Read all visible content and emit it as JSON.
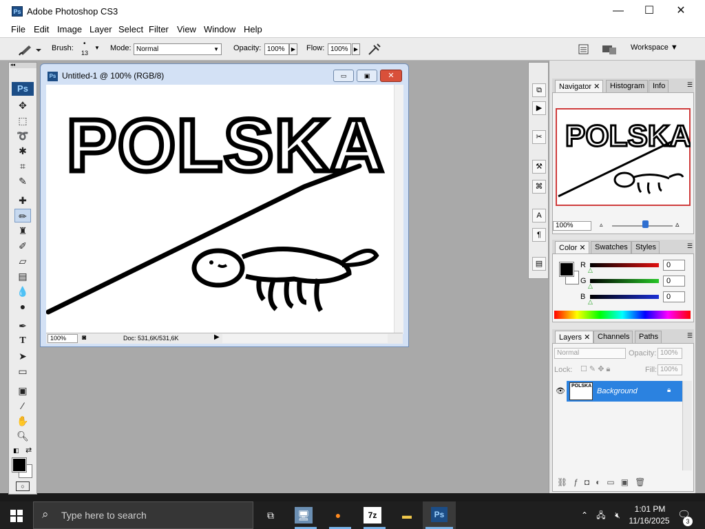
{
  "app": {
    "title": "Adobe Photoshop CS3",
    "icon_text": "Ps"
  },
  "window_controls": {
    "minimize": "—",
    "maximize": "☐",
    "close": "✕"
  },
  "menu": [
    "File",
    "Edit",
    "Image",
    "Layer",
    "Select",
    "Filter",
    "View",
    "Window",
    "Help"
  ],
  "options_bar": {
    "brush_label": "Brush:",
    "brush_size": "13",
    "mode_label": "Mode:",
    "mode_value": "Normal",
    "opacity_label": "Opacity:",
    "opacity_value": "100%",
    "flow_label": "Flow:",
    "flow_value": "100%",
    "workspace_label": "Workspace"
  },
  "tools_panel": {
    "logo": "Ps"
  },
  "document": {
    "title": "Untitled-1 @ 100% (RGB/8)",
    "zoom": "100%",
    "doc_info": "Doc: 531,6K/531,6K",
    "drawing_text": "POLSKA"
  },
  "navigator": {
    "tabs": [
      "Navigator",
      "Histogram",
      "Info"
    ],
    "zoom": "100%",
    "zoom_slider_level": 0.55
  },
  "color_panel": {
    "tabs": [
      "Color",
      "Swatches",
      "Styles"
    ],
    "channels": [
      {
        "label": "R",
        "value": "0",
        "color": "#d21f1f"
      },
      {
        "label": "G",
        "value": "0",
        "color": "#27c627"
      },
      {
        "label": "B",
        "value": "0",
        "color": "#1a2fd6"
      }
    ]
  },
  "layers_panel": {
    "tabs": [
      "Layers",
      "Channels",
      "Paths"
    ],
    "blend_mode": "Normal",
    "opacity_label": "Opacity:",
    "opacity_value": "100%",
    "lock_label": "Lock:",
    "fill_label": "Fill:",
    "fill_value": "100%",
    "layer_name": "Background"
  },
  "taskbar": {
    "search_placeholder": "Type here to search",
    "time": "1:01 PM",
    "date": "11/16/2025",
    "notifications": "3",
    "ps_label": "Ps",
    "archive_label": "7z"
  },
  "colors": {
    "accent": "#2475d6",
    "layer_selected": "#2b82e0"
  }
}
